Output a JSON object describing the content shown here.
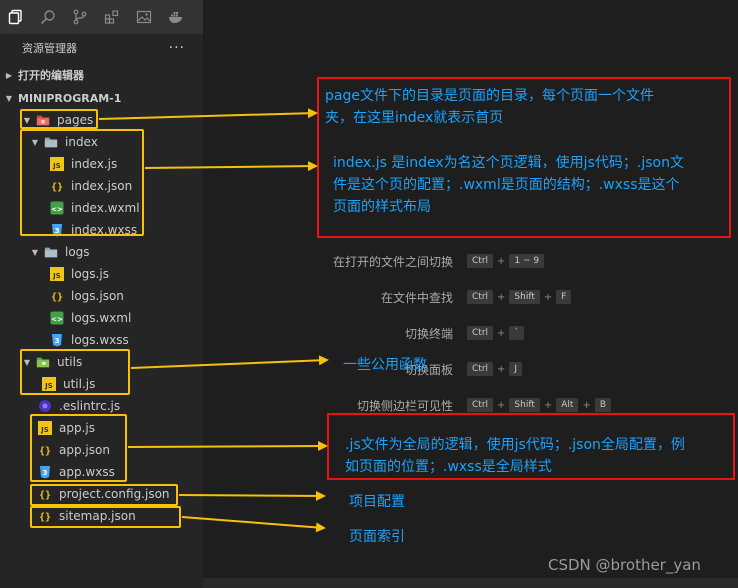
{
  "activity_bar": {
    "icons": [
      "explorer-icon",
      "search-icon",
      "source-control-icon",
      "extensions-icon",
      "image-icon",
      "docker-icon"
    ]
  },
  "explorer": {
    "title": "资源管理器",
    "menu": "···",
    "open_editors": "打开的编辑器",
    "project": "MINIPROGRAM-1",
    "tree": [
      {
        "label": "pages",
        "type": "folder-red"
      },
      {
        "label": "index",
        "type": "folder"
      },
      {
        "label": "index.js",
        "type": "js"
      },
      {
        "label": "index.json",
        "type": "json"
      },
      {
        "label": "index.wxml",
        "type": "wxml"
      },
      {
        "label": "index.wxss",
        "type": "wxss"
      },
      {
        "label": "logs",
        "type": "folder"
      },
      {
        "label": "logs.js",
        "type": "js"
      },
      {
        "label": "logs.json",
        "type": "json"
      },
      {
        "label": "logs.wxml",
        "type": "wxml"
      },
      {
        "label": "logs.wxss",
        "type": "wxss"
      },
      {
        "label": "utils",
        "type": "folder-green"
      },
      {
        "label": "util.js",
        "type": "js"
      },
      {
        "label": ".eslintrc.js",
        "type": "eslint"
      },
      {
        "label": "app.js",
        "type": "js"
      },
      {
        "label": "app.json",
        "type": "json"
      },
      {
        "label": "app.wxss",
        "type": "wxss"
      },
      {
        "label": "project.config.json",
        "type": "json"
      },
      {
        "label": "sitemap.json",
        "type": "json"
      }
    ]
  },
  "shortcuts": [
    {
      "label": "在打开的文件之间切换",
      "keys": [
        "Ctrl",
        "1 ~ 9"
      ]
    },
    {
      "label": "在文件中查找",
      "keys": [
        "Ctrl",
        "Shift",
        "F"
      ]
    },
    {
      "label": "切换终端",
      "keys": [
        "Ctrl",
        "`"
      ]
    },
    {
      "label": "切换面板",
      "keys": [
        "Ctrl",
        "J"
      ]
    },
    {
      "label": "切换侧边栏可见性",
      "keys": [
        "Ctrl",
        "Shift",
        "Alt",
        "B"
      ]
    }
  ],
  "annotations": {
    "pages_note_line1": "page文件下的目录是页面的目录，每个页面一个文件",
    "pages_note_line2": "夹，在这里index就表示首页",
    "index_note_line1": "index.js 是index为名这个页逻辑，使用js代码；.json文",
    "index_note_line2": "件是这个页的配置；.wxml是页面的结构；.wxss是这个",
    "index_note_line3": "页面的样式布局",
    "utils_note": "一些公用函数",
    "app_note_line1": ".js文件为全局的逻辑，使用js代码；.json全局配置，例",
    "app_note_line2": "如页面的位置；.wxss是全局样式",
    "project_note": "项目配置",
    "sitemap_note": "页面索引"
  },
  "watermark": "CSDN @brother_yan"
}
